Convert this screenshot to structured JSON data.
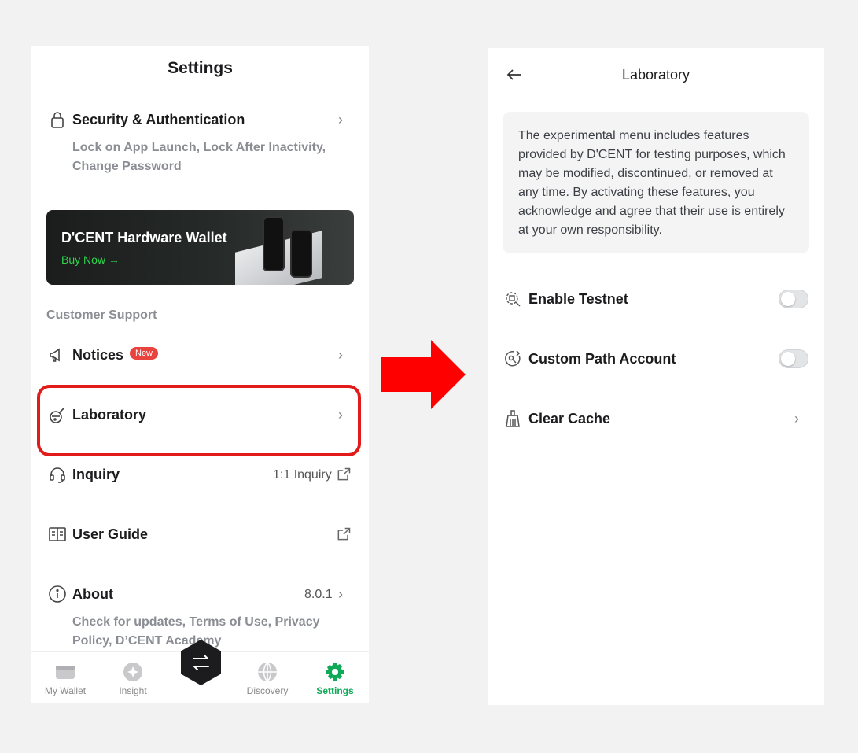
{
  "settings": {
    "title": "Settings",
    "security": {
      "title": "Security & Authentication",
      "subtitle_line1": "Lock on App Launch, Lock After Inactivity,",
      "subtitle_line2": "Change Password"
    },
    "banner": {
      "title": "D'CENT Hardware Wallet",
      "cta": "Buy Now →"
    },
    "support_section": "Customer Support",
    "notices": {
      "label": "Notices",
      "badge": "New"
    },
    "laboratory": {
      "label": "Laboratory"
    },
    "inquiry": {
      "label": "Inquiry",
      "value": "1:1 Inquiry"
    },
    "user_guide": {
      "label": "User Guide"
    },
    "about": {
      "label": "About",
      "version": "8.0.1",
      "subtitle_line1": "Check for updates, Terms of Use, Privacy",
      "subtitle_line2": "Policy, D’CENT Academy"
    }
  },
  "tabbar": {
    "tabs": [
      {
        "label": "My Wallet",
        "icon": "wallet-icon"
      },
      {
        "label": "Insight",
        "icon": "insight-icon"
      },
      {
        "label": "Discovery",
        "icon": "globe-icon"
      },
      {
        "label": "Settings",
        "icon": "gear-icon",
        "active": true
      }
    ],
    "center_icon": "swap-icon"
  },
  "laboratory_page": {
    "title": "Laboratory",
    "description": "The experimental menu includes features provided by D'CENT for testing purposes, which may be modified, discontinued, or removed at any time. By activating these features, you acknowledge and agree that their use is entirely at your own responsibility.",
    "items": [
      {
        "label": "Enable Testnet",
        "control": "toggle",
        "enabled": false
      },
      {
        "label": "Custom Path Account",
        "control": "toggle",
        "enabled": false
      },
      {
        "label": "Clear Cache",
        "control": "chevron"
      }
    ]
  },
  "colors": {
    "accent": "#0fa958",
    "highlight": "#e21a1a",
    "arrow": "#ff0000",
    "badge": "#e8433f"
  }
}
